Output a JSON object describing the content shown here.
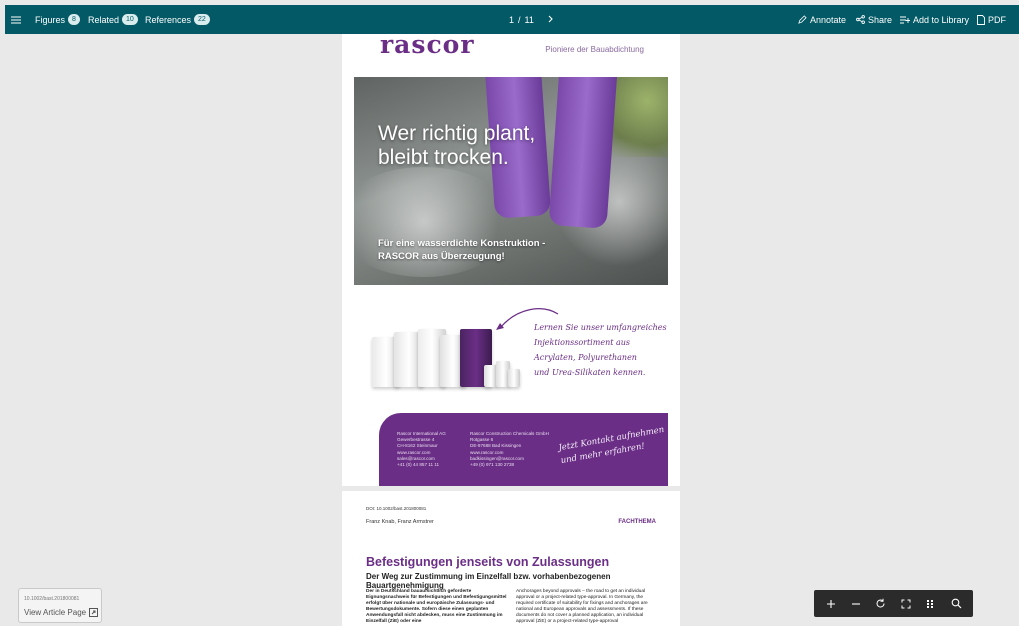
{
  "toolbar": {
    "figures_label": "Figures",
    "figures_count": "8",
    "related_label": "Related",
    "related_count": "10",
    "references_label": "References",
    "references_count": "22",
    "page_current": "1",
    "page_separator": "/",
    "page_total": "11",
    "annotate_label": "Annotate",
    "share_label": "Share",
    "library_label": "Add to Library",
    "pdf_label": "PDF"
  },
  "page1": {
    "logo": "rascor",
    "tagline": "Pioniere der Bauabdichtung",
    "headline_1": "Wer richtig plant,",
    "headline_2": "bleibt trocken.",
    "subline_1": "Für eine wasserdichte Konstruktion -",
    "subline_2": "RASCOR aus Überzeugung!",
    "script_lines": [
      "Lernen Sie unser umfangreiches",
      "Injektionssortiment aus",
      "Acrylaten, Polyurethanen",
      "und Urea-Silikaten kennen."
    ],
    "contact_left": [
      "Rascor International AG",
      "Gewerbestrasse 4",
      "CH-8162 Steinmaur",
      "www.rascor.com",
      "sales@rascor.com",
      "+41 (0) 44 857 11 11"
    ],
    "contact_right": [
      "Rascor Construction Chemicals GmbH",
      "Rotgasse 6",
      "DE-97688 Bad Kissingen",
      "www.rascor.com",
      "badkissingen@rascor.com",
      "+49 (0) 971 130 2738"
    ],
    "contact_script_1": "Jetzt Kontakt aufnehmen",
    "contact_script_2": "und mehr erfahren!"
  },
  "page2": {
    "doi": "DOI: 10.1002/bast.201800081",
    "authors": "Franz Knab, Franz Armstrer",
    "section": "FACHTHEMA",
    "title": "Befestigungen jenseits von Zulassungen",
    "subtitle": "Der Weg zur Zustimmung im Einzelfall bzw. vorhabenbezogenen Bauartgenehmigung",
    "col_left": "Der in Deutschland bauaufsichtlich geforderte Eignungsnachweis für Befestigungen und Befestigungsmittel erfolgt über nationale und europäische Zulassungs- und Bewertungsdokumente. Sofern diese einen geplanten Anwendungsfall nicht abdecken, muss eine Zustimmung im Einzelfall (ZiE) oder eine",
    "col_right": "Anchorages beyond approvals – the road to get an individual approval or a project-related type-approval. In Germany, the required certificate of suitability for fixings and anchorages are national and European approvals and assessments. If these documents do not cover a planned application, an individual approval (ZiE) or a project-related type-approval"
  },
  "doi_card": {
    "doi": "10.1002/bast.201800081",
    "link_label": "View Article Page"
  },
  "zoom": {
    "icons": [
      "plus-icon",
      "minus-icon",
      "rotate-icon",
      "fullscreen-icon",
      "grid-icon",
      "search-icon"
    ]
  },
  "colors": {
    "toolbar": "#035a66",
    "brand": "#6b2e86"
  }
}
